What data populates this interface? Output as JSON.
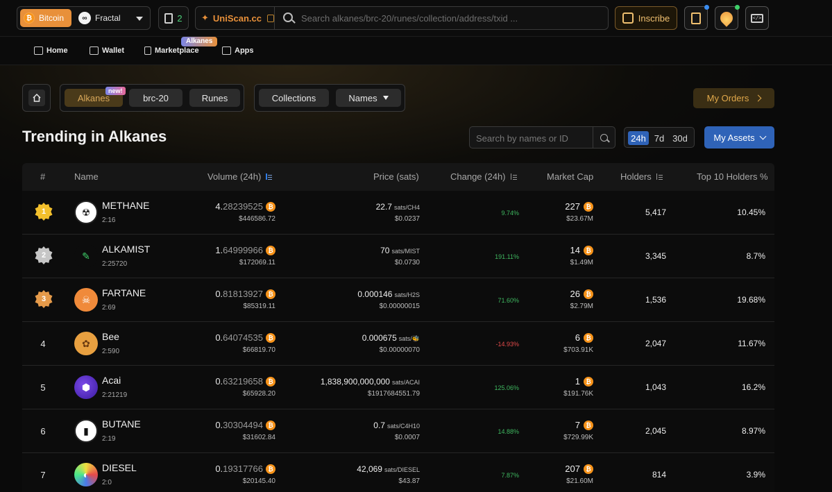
{
  "topbar": {
    "network_active": "Bitcoin",
    "network_other": "Fractal",
    "pending_count": "2",
    "uniscan_label": "UniScan.cc",
    "search_placeholder": "Search alkanes/brc-20/runes/collection/address/txid ...",
    "inscribe_label": "Inscribe",
    "accent_color": "#e8903a"
  },
  "nav": {
    "home": "Home",
    "wallet": "Wallet",
    "marketplace": "Marketplace",
    "marketplace_badge": "Alkanes",
    "apps": "Apps"
  },
  "filters": {
    "tabs": [
      "Alkanes",
      "brc-20",
      "Runes"
    ],
    "new_badge": "new!",
    "collections": "Collections",
    "names": "Names",
    "my_orders": "My Orders"
  },
  "main": {
    "title": "Trending in Alkanes",
    "search_placeholder": "Search by names or ID",
    "periods": [
      "24h",
      "7d",
      "30d"
    ],
    "active_period": "24h",
    "my_assets": "My Assets"
  },
  "table": {
    "headers": {
      "rank": "#",
      "name": "Name",
      "volume": "Volume (24h)",
      "price": "Price (sats)",
      "change": "Change (24h)",
      "market_cap": "Market Cap",
      "holders": "Holders",
      "top10": "Top 10 Holders %"
    },
    "rows": [
      {
        "rank": "1",
        "medal": "gold",
        "name": "METHANE",
        "id": "2:16",
        "vol_int": "4.",
        "vol_dec": "28239525",
        "vol_usd": "$446586.72",
        "price": "22.7",
        "price_unit": "sats/CH4",
        "price_usd": "$0.0237",
        "change": "9.74%",
        "dir": "up",
        "mcap": "227",
        "mcap_usd": "$23.67M",
        "holders": "5,417",
        "top10": "10.45%"
      },
      {
        "rank": "2",
        "medal": "silver",
        "name": "ALKAMIST",
        "id": "2:25720",
        "vol_int": "1.",
        "vol_dec": "64999966",
        "vol_usd": "$172069.11",
        "price": "70",
        "price_unit": "sats/MIST",
        "price_usd": "$0.0730",
        "change": "191.11%",
        "dir": "up",
        "mcap": "14",
        "mcap_usd": "$1.49M",
        "holders": "3,345",
        "top10": "8.7%"
      },
      {
        "rank": "3",
        "medal": "bronze",
        "name": "FARTANE",
        "id": "2:69",
        "vol_int": "0.",
        "vol_dec": "81813927",
        "vol_usd": "$85319.11",
        "price": "0.000146",
        "price_unit": "sats/H2S",
        "price_usd": "$0.00000015",
        "change": "71.60%",
        "dir": "up",
        "mcap": "26",
        "mcap_usd": "$2.79M",
        "holders": "1,536",
        "top10": "19.68%"
      },
      {
        "rank": "4",
        "medal": "",
        "name": "Bee",
        "id": "2:590",
        "vol_int": "0.",
        "vol_dec": "64074535",
        "vol_usd": "$66819.70",
        "price": "0.000675",
        "price_unit": "sats/🐝",
        "price_usd": "$0.00000070",
        "change": "-14.93%",
        "dir": "down",
        "mcap": "6",
        "mcap_usd": "$703.91K",
        "holders": "2,047",
        "top10": "11.67%"
      },
      {
        "rank": "5",
        "medal": "",
        "name": "Acai",
        "id": "2:21219",
        "vol_int": "0.",
        "vol_dec": "63219658",
        "vol_usd": "$65928.20",
        "price": "1,838,900,000,000",
        "price_unit": "sats/ACAI",
        "price_usd": "$1917684551.79",
        "change": "125.06%",
        "dir": "up",
        "mcap": "1",
        "mcap_usd": "$191.76K",
        "holders": "1,043",
        "top10": "16.2%"
      },
      {
        "rank": "6",
        "medal": "",
        "name": "BUTANE",
        "id": "2:19",
        "vol_int": "0.",
        "vol_dec": "30304494",
        "vol_usd": "$31602.84",
        "price": "0.7",
        "price_unit": "sats/C4H10",
        "price_usd": "$0.0007",
        "change": "14.88%",
        "dir": "up",
        "mcap": "7",
        "mcap_usd": "$729.99K",
        "holders": "2,045",
        "top10": "8.97%"
      },
      {
        "rank": "7",
        "medal": "",
        "name": "DIESEL",
        "id": "2:0",
        "vol_int": "0.",
        "vol_dec": "19317766",
        "vol_usd": "$20145.40",
        "price": "42,069",
        "price_unit": "sats/DIESEL",
        "price_usd": "$43.87",
        "change": "7.87%",
        "dir": "up",
        "mcap": "207",
        "mcap_usd": "$21.60M",
        "holders": "814",
        "top10": "3.9%"
      }
    ]
  }
}
